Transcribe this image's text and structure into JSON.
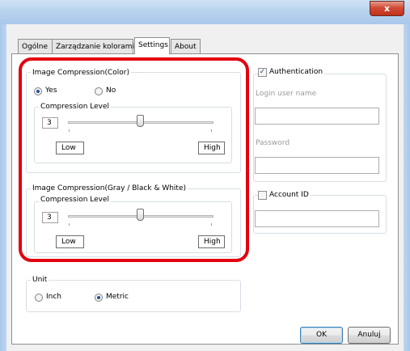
{
  "window": {
    "close_glyph": "x"
  },
  "tabs": [
    "Ogólne",
    "Zarządzanie kolorami",
    "Settings",
    "About"
  ],
  "color_compression": {
    "title": "Image Compression(Color)",
    "yes_label": "Yes",
    "no_label": "No",
    "selected": "Yes",
    "level_title": "Compression Level",
    "level_value": "3",
    "low_label": "Low",
    "high_label": "High"
  },
  "gray_compression": {
    "title": "Image Compression(Gray / Black & White)",
    "level_title": "Compression Level",
    "level_value": "3",
    "low_label": "Low",
    "high_label": "High"
  },
  "unit": {
    "title": "Unit",
    "inch_label": "Inch",
    "metric_label": "Metric",
    "selected": "Metric"
  },
  "authentication": {
    "label": "Authentication",
    "checked": true,
    "check_glyph": "✓",
    "login_placeholder": "Login user name",
    "password_placeholder": "Password"
  },
  "account": {
    "label": "Account ID",
    "checked": false
  },
  "buttons": {
    "ok": "OK",
    "cancel": "Anuluj"
  },
  "colors": {
    "highlight": "#e3000f",
    "radio_dot": "#1e4fa0"
  }
}
